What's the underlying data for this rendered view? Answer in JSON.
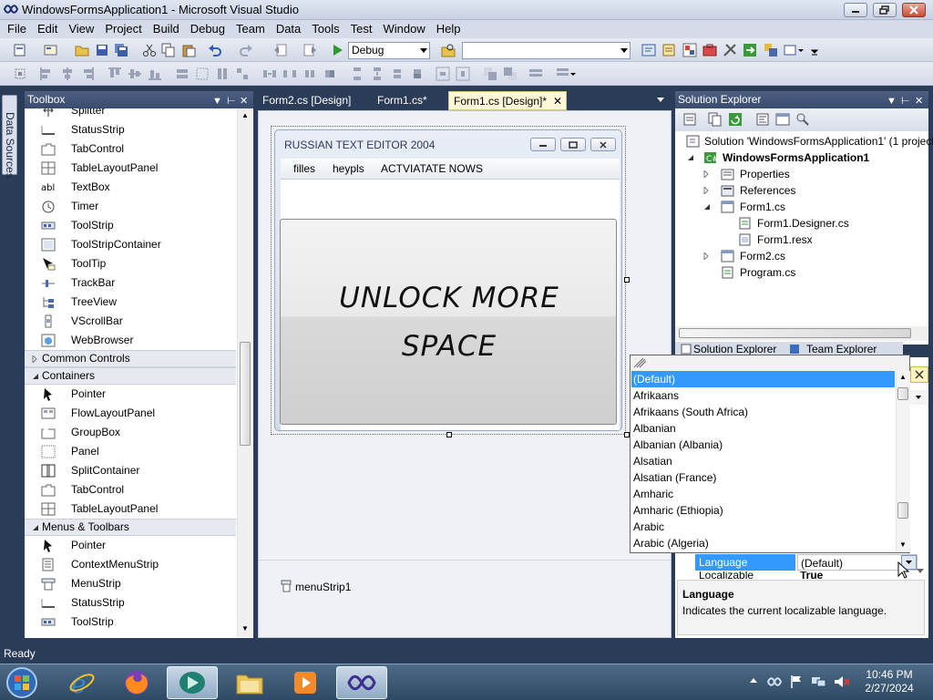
{
  "window": {
    "title": "WindowsFormsApplication1 - Microsoft Visual Studio"
  },
  "menubar": [
    "File",
    "Edit",
    "View",
    "Project",
    "Build",
    "Debug",
    "Team",
    "Data",
    "Tools",
    "Test",
    "Window",
    "Help"
  ],
  "toolbar": {
    "config_value": "Debug",
    "platform_value": ""
  },
  "left_strip": {
    "tab_label": "Data Sources"
  },
  "toolbox": {
    "title": "Toolbox",
    "items_a": [
      "Splitter",
      "StatusStrip",
      "TabControl",
      "TableLayoutPanel",
      "TextBox",
      "Timer",
      "ToolStrip",
      "ToolStripContainer",
      "ToolTip",
      "TrackBar",
      "TreeView",
      "VScrollBar",
      "WebBrowser"
    ],
    "group_common": "Common Controls",
    "group_containers": "Containers",
    "items_containers": [
      "Pointer",
      "FlowLayoutPanel",
      "GroupBox",
      "Panel",
      "SplitContainer",
      "TabControl",
      "TableLayoutPanel"
    ],
    "group_menus": "Menus & Toolbars",
    "items_menus": [
      "Pointer",
      "ContextMenuStrip",
      "MenuStrip",
      "StatusStrip",
      "ToolStrip"
    ]
  },
  "doc_tabs": [
    "Form2.cs [Design]",
    "Form1.cs*",
    "Form1.cs [Design]*"
  ],
  "form": {
    "title": "RUSSIAN TEXT EDITOR 2004",
    "menu": [
      "filles",
      "heypls",
      "ACTVIATATE NOWS"
    ],
    "button_line1": "UNLOCK MORE",
    "button_line2": "SPACE"
  },
  "tray": {
    "component": "menuStrip1"
  },
  "solution_explorer": {
    "title": "Solution Explorer",
    "solution": "Solution 'WindowsFormsApplication1' (1 project)",
    "project": "WindowsFormsApplication1",
    "nodes": [
      "Properties",
      "References",
      "Form1.cs",
      "Form1.Designer.cs",
      "Form1.resx",
      "Form2.cs",
      "Program.cs"
    ],
    "bottom_tabs": [
      "Solution Explorer",
      "Team Explorer"
    ]
  },
  "properties": {
    "row_name": "Language",
    "row_value": "(Default)",
    "row2_name": "Localizable",
    "row2_value": "True",
    "desc_title": "Language",
    "desc_text": "Indicates the current localizable language."
  },
  "language_list": [
    "(Default)",
    "Afrikaans",
    "Afrikaans (South Africa)",
    "Albanian",
    "Albanian (Albania)",
    "Alsatian",
    "Alsatian (France)",
    "Amharic",
    "Amharic (Ethiopia)",
    "Arabic",
    "Arabic (Algeria)"
  ],
  "status": {
    "text": "Ready"
  },
  "clock": {
    "time": "10:46 PM",
    "date": "2/27/2024"
  }
}
